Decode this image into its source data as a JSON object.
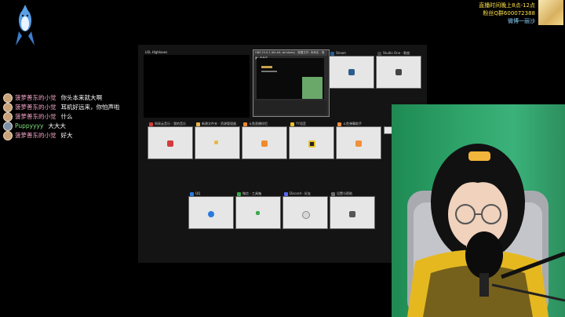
{
  "stream_info": {
    "line1": "直播时间晚上8点-12点",
    "line2": "粉丝Q群600072388",
    "line3": "微博一丽沙"
  },
  "chat": [
    {
      "user": "菠萝善东的小觉",
      "message": "你头本来就大啊",
      "name_color": "pink"
    },
    {
      "user": "菠萝善东的小觉",
      "message": "耳机好远来，你怕声啦",
      "name_color": "pink"
    },
    {
      "user": "菠萝善东的小觉",
      "message": "什么",
      "name_color": "pink"
    },
    {
      "user": "Puppyyyy",
      "message": "大大大",
      "name_color": "green"
    },
    {
      "user": "菠萝善东的小觉",
      "message": "好大",
      "name_color": "pink"
    }
  ],
  "task_view": {
    "top_window": {
      "title": "LOL Highlaxes"
    },
    "obs_window": {
      "title": "OBS 23.0.2 (64-bit, windows) - 配置文件: 未命名 - 场景: 未命名"
    },
    "row1": [
      {
        "title": "Steam",
        "icon_name": "steam-icon",
        "icon_color": "#2a5d8a"
      },
      {
        "title": "Studio One - 歌曲",
        "icon_name": "studio-one-icon",
        "icon_color": "#444444"
      }
    ],
    "row2": [
      {
        "title": "网易云音乐 - 我的音乐",
        "icon_name": "netease-music-icon",
        "icon_color": "#d43c3c"
      },
      {
        "title": "新建文件夹 - 资源管理器",
        "icon_name": "file-explorer-icon",
        "icon_color": "#e8b64a"
      },
      {
        "title": "斗鱼直播伴侣",
        "icon_name": "douyu-icon",
        "icon_color": "#f08a2a"
      },
      {
        "title": "YY语音",
        "icon_name": "yy-icon",
        "icon_color": "#e8c02a"
      },
      {
        "title": "斗鱼弹幕助手",
        "icon_name": "danmaku-icon",
        "icon_color": "#f0903a"
      }
    ],
    "row3": [
      {
        "title": "QQ",
        "icon_name": "qq-icon",
        "icon_color": "#2a7ae0"
      },
      {
        "title": "微信 - 工具箱",
        "icon_name": "chrome-icon",
        "icon_color": "#3aa84a"
      },
      {
        "title": "Discord - 好友",
        "icon_name": "discord-icon",
        "icon_color": "#5865f2"
      },
      {
        "title": "设置与帮助",
        "icon_name": "settings-icon",
        "icon_color": "#6a6a6a"
      }
    ]
  },
  "colors": {
    "info_yellow": "#ffe04a",
    "info_blue": "#8fd3ff",
    "chat_pink": "#f3a5c6",
    "chat_green": "#7fe07f",
    "greenscreen": "#2ea36a"
  }
}
